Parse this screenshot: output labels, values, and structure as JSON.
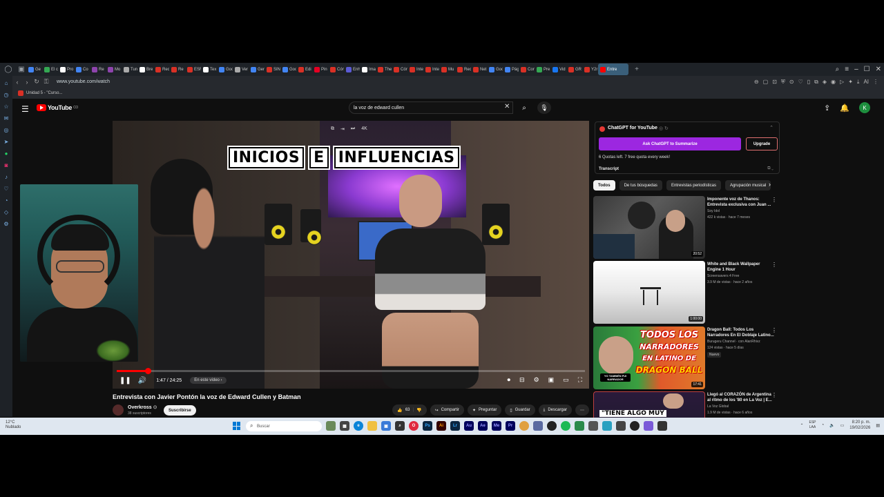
{
  "browser": {
    "tabs": [
      {
        "label": "Ge",
        "color": "#4285f4"
      },
      {
        "label": "El c",
        "color": "#34a853"
      },
      {
        "label": "Pro",
        "color": "#ffffff"
      },
      {
        "label": "Co",
        "color": "#4285f4"
      },
      {
        "label": "Re",
        "color": "#8e44ad"
      },
      {
        "label": "Mo",
        "color": "#8e44ad"
      },
      {
        "label": "Tun",
        "color": "#aaaaaa"
      },
      {
        "label": "Bre",
        "color": "#ffffff"
      },
      {
        "label": "Rec",
        "color": "#d93025"
      },
      {
        "label": "Re",
        "color": "#d93025"
      },
      {
        "label": "ESF",
        "color": "#d93025"
      },
      {
        "label": "Tex",
        "color": "#ffffff"
      },
      {
        "label": "Goo",
        "color": "#4285f4"
      },
      {
        "label": "Ver",
        "color": "#aaaaaa"
      },
      {
        "label": "Gen",
        "color": "#4285f4"
      },
      {
        "label": "SIN",
        "color": "#d93025"
      },
      {
        "label": "Goo",
        "color": "#4285f4"
      },
      {
        "label": "Edi",
        "color": "#d93025"
      },
      {
        "label": "Pin",
        "color": "#e60023"
      },
      {
        "label": "Cón",
        "color": "#d93025"
      },
      {
        "label": "Enh",
        "color": "#5b5bd6"
      },
      {
        "label": "Ima",
        "color": "#ffffff"
      },
      {
        "label": "The",
        "color": "#d93025"
      },
      {
        "label": "Cón",
        "color": "#d93025"
      },
      {
        "label": "Inte",
        "color": "#d93025"
      },
      {
        "label": "Inte",
        "color": "#d93025"
      },
      {
        "label": "Mu",
        "color": "#d93025"
      },
      {
        "label": "Rec",
        "color": "#d93025"
      },
      {
        "label": "Net",
        "color": "#d93025"
      },
      {
        "label": "Goo",
        "color": "#4285f4"
      },
      {
        "label": "Pág",
        "color": "#4285f4"
      },
      {
        "label": "Con",
        "color": "#d93025"
      },
      {
        "label": "Pre",
        "color": "#34a853"
      },
      {
        "label": "Vid",
        "color": "#1877f2"
      },
      {
        "label": "GR",
        "color": "#d93025"
      },
      {
        "label": "Y2r",
        "color": "#d93025"
      }
    ],
    "active_tab_label": "Entre",
    "url": "www.youtube.com/watch",
    "bookmark": "Unidad 5 - \"Curso...",
    "addr_ai": "AI"
  },
  "youtube": {
    "logo_text": "YouTube",
    "logo_region": "CO",
    "search_query": "la voz de edward cullen",
    "avatar_letter": "K",
    "video": {
      "overlay_words": [
        "INICIOS",
        "E",
        "INFLUENCIAS"
      ],
      "top_badge": "4K",
      "progress": 0.067,
      "timecode": "1:47 / 24:25",
      "chapter": "En este vídeo  ›"
    },
    "title": "Entrevista con Javier Pontón la voz de Edward Cullen y Batman",
    "channel": {
      "name": "Overkross",
      "subs": "38 suscriptores",
      "subscribe_label": "Suscribirse"
    },
    "actions": {
      "likes": "63",
      "share": "Compartir",
      "ask": "Preguntar",
      "save": "Guardar",
      "download": "Descargar"
    },
    "gpt": {
      "title": "ChatGPT for YouTube",
      "summarize": "Ask ChatGPT to Summarize",
      "upgrade": "Upgrade",
      "quota": "6 Quotas left. 7 free quota every week!",
      "transcript": "Transcript"
    },
    "chips": [
      "Todos",
      "De tus búsquedas",
      "Entrevistas periodísticas",
      "Agrupación musical"
    ],
    "recommendations": [
      {
        "title": "Imponente voz de Thanos: Entrevista exclusiva con Juan ...",
        "channel": "Soy Idol",
        "meta": "422 k vistas · hace 7 meses",
        "duration": "20:52",
        "badge": "",
        "thumb": "studio"
      },
      {
        "title": "White and Black Wallpaper Engine 1 Hour",
        "channel": "Screensavers 4 Free",
        "meta": "3.9 M de vistas · hace 2 años",
        "duration": "1:00:00",
        "badge": "",
        "thumb": "fog"
      },
      {
        "title": "Dragon Ball: Todos Los Narradores En El Doblaje Latino...",
        "channel": "Burugeru Channel · con AlanRhivz",
        "meta": "124 vistas · hace 5 días",
        "duration": "17:41",
        "badge": "Nuevo",
        "thumb": "dragon",
        "thumb_text": [
          "TODOS LOS",
          "NARRADORES",
          "EN LATINO DE",
          "DRAGON BALL"
        ],
        "thumb_tag": "YO TAMBIÉN FUI NARRADOR"
      },
      {
        "title": "Llegó al CORAZÓN de Argentina al ritmo de los '80 en La Voz | E...",
        "channel": "La Voz Global",
        "meta": "1.9 M de vistas · hace 6 años",
        "duration": "",
        "badge": "",
        "thumb": "voz",
        "thumb_text": [
          "\"TIENE ALGO MUY"
        ]
      }
    ]
  },
  "taskbar": {
    "weather_temp": "12°C",
    "weather_desc": "Nublado",
    "search_placeholder": "Buscar",
    "lang1": "ESP",
    "lang2": "LAA",
    "time": "8:20 p. m.",
    "date": "19/02/2026"
  }
}
